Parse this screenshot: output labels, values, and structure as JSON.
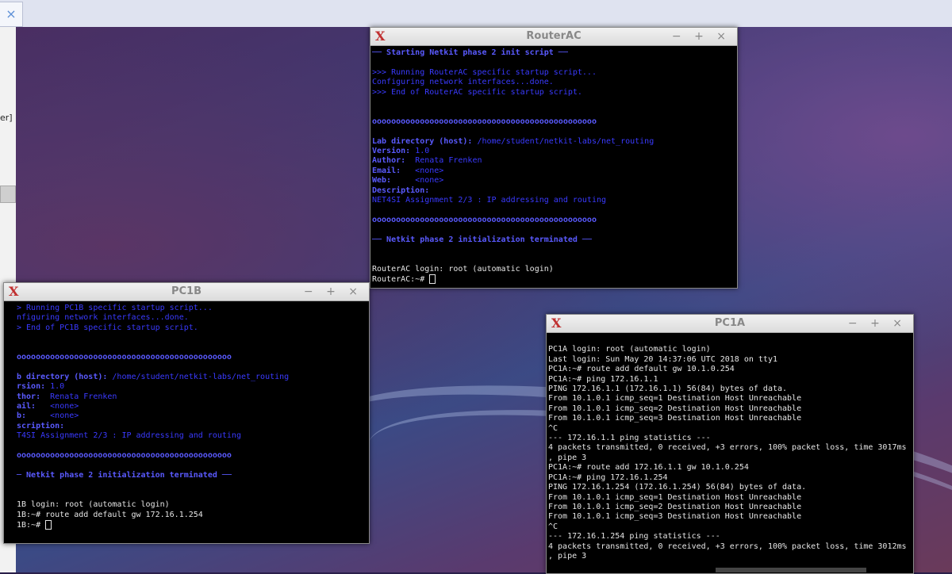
{
  "browser": {
    "tab_close": "×"
  },
  "left_panel": {
    "stub": "er]"
  },
  "windows": {
    "router_ac": {
      "title": "RouterAC",
      "controls": "− + ×",
      "lines": [
        "── Starting Netkit phase 2 init script ──",
        "",
        ">>> Running RouterAC specific startup script...",
        "Configuring network interfaces...done.",
        ">>> End of RouterAC specific startup script.",
        "",
        "",
        "ooooooooooooooooooooooooooooooooooooooooooooooo",
        "",
        "Lab directory (host): /home/student/netkit-labs/net_routing",
        "Version: 1.0",
        "Author:  Renata Frenken",
        "Email:   <none>",
        "Web:     <none>",
        "Description:",
        "NET4SI Assignment 2/3 : IP addressing and routing",
        "",
        "ooooooooooooooooooooooooooooooooooooooooooooooo",
        "",
        "── Netkit phase 2 initialization terminated ──",
        "",
        "",
        "RouterAC login: root (automatic login)",
        "RouterAC:~# "
      ]
    },
    "pc1b": {
      "title": "PC1B",
      "controls": "− + ×",
      "lines": [
        "> Running PC1B specific startup script...",
        "nfiguring network interfaces...done.",
        "> End of PC1B specific startup script.",
        "",
        "",
        "ooooooooooooooooooooooooooooooooooooooooooooo",
        "",
        "b directory (host): /home/student/netkit-labs/net_routing",
        "rsion: 1.0",
        "thor:  Renata Frenken",
        "ail:   <none>",
        "b:     <none>",
        "scription:",
        "T4SI Assignment 2/3 : IP addressing and routing",
        "",
        "ooooooooooooooooooooooooooooooooooooooooooooo",
        "",
        "─ Netkit phase 2 initialization terminated ──",
        "",
        "",
        "1B login: root (automatic login)",
        "1B:~# route add default gw 172.16.1.254",
        "1B:~# "
      ]
    },
    "pc1a": {
      "title": "PC1A",
      "controls": "− + ×",
      "lines": [
        "",
        "PC1A login: root (automatic login)",
        "Last login: Sun May 20 14:37:06 UTC 2018 on tty1",
        "PC1A:~# route add default gw 10.1.0.254",
        "PC1A:~# ping 172.16.1.1",
        "PING 172.16.1.1 (172.16.1.1) 56(84) bytes of data.",
        "From 10.1.0.1 icmp_seq=1 Destination Host Unreachable",
        "From 10.1.0.1 icmp_seq=2 Destination Host Unreachable",
        "From 10.1.0.1 icmp_seq=3 Destination Host Unreachable",
        "^C",
        "--- 172.16.1.1 ping statistics ---",
        "4 packets transmitted, 0 received, +3 errors, 100% packet loss, time 3017ms",
        ", pipe 3",
        "PC1A:~# route add 172.16.1.1 gw 10.1.0.254",
        "PC1A:~# ping 172.16.1.254",
        "PING 172.16.1.254 (172.16.1.254) 56(84) bytes of data.",
        "From 10.1.0.1 icmp_seq=1 Destination Host Unreachable",
        "From 10.1.0.1 icmp_seq=2 Destination Host Unreachable",
        "From 10.1.0.1 icmp_seq=3 Destination Host Unreachable",
        "^C",
        "--- 172.16.1.254 ping statistics ---",
        "4 packets transmitted, 0 received, +3 errors, 100% packet loss, time 3012ms",
        ", pipe 3"
      ]
    }
  }
}
